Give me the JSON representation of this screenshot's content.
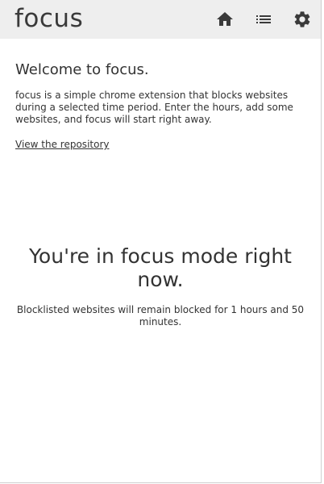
{
  "header": {
    "logo": "focus",
    "nav": [
      {
        "name": "home-icon"
      },
      {
        "name": "list-icon"
      },
      {
        "name": "gear-icon"
      }
    ]
  },
  "welcome": {
    "title": "Welcome to focus.",
    "description": "focus is a simple chrome extension that blocks websites during a selected time period. Enter the hours, add some websites, and focus will start right away.",
    "link_label": "View the repository"
  },
  "focus_mode": {
    "title": "You're in focus mode right now.",
    "message": "Blocklisted websites will remain blocked for 1 hours and 50 minutes."
  }
}
